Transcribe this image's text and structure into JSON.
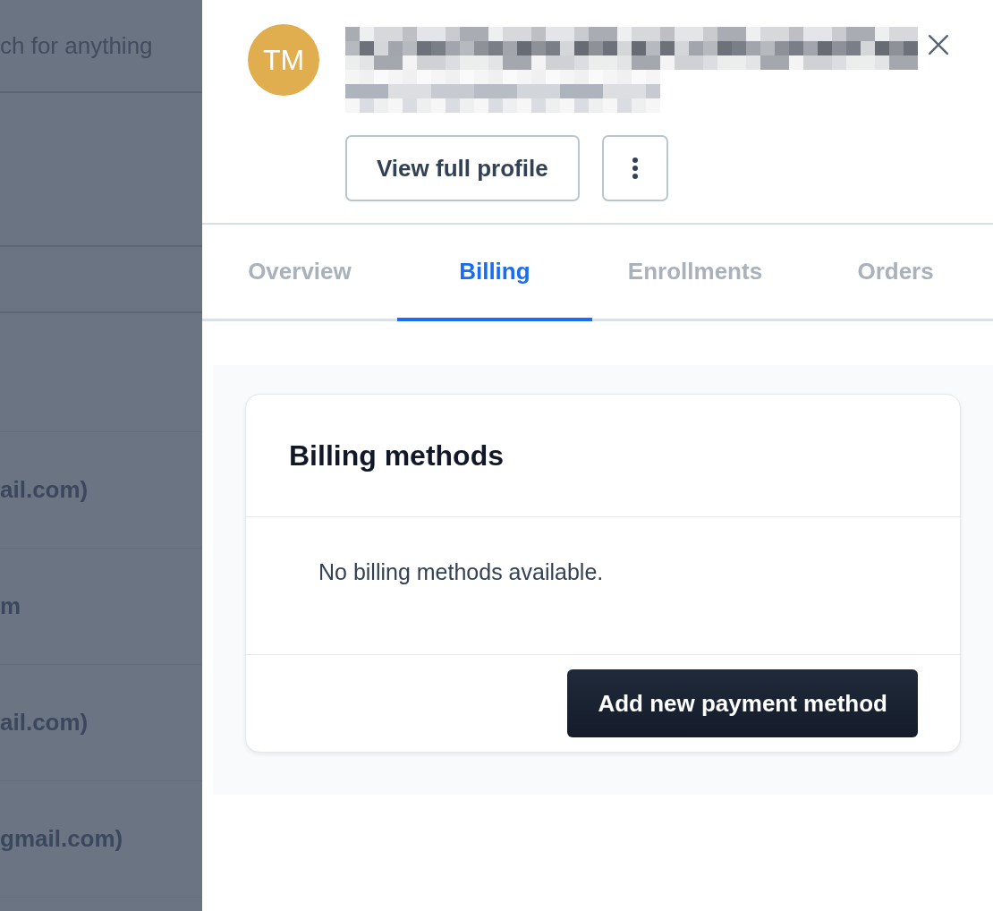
{
  "background_page": {
    "search": {
      "placeholder": "ch for anything"
    },
    "rows": [
      {
        "text": "ail.com)"
      },
      {
        "text": "m"
      },
      {
        "text": "ail.com)"
      },
      {
        "text": "gmail.com)"
      }
    ]
  },
  "drawer": {
    "avatar": {
      "initials": "TM"
    },
    "actions": {
      "view_profile": "View full profile"
    },
    "tabs": [
      {
        "label": "Overview",
        "selected": false
      },
      {
        "label": "Billing",
        "selected": true
      },
      {
        "label": "Enrollments",
        "selected": false
      },
      {
        "label": "Orders",
        "selected": false
      }
    ],
    "billing_card": {
      "title": "Billing methods",
      "empty_message": "No billing methods available.",
      "action": "Add new payment method"
    }
  }
}
